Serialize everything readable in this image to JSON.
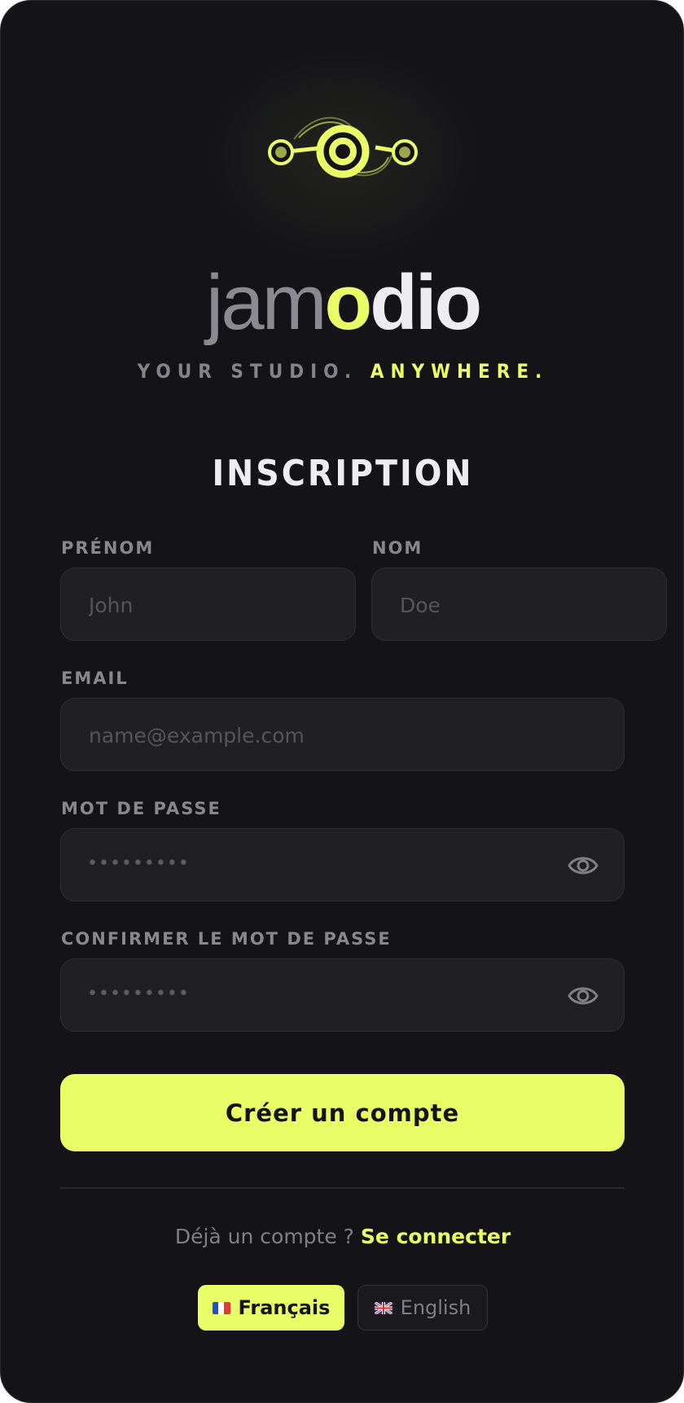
{
  "brand": {
    "wordmark_light": "jam",
    "wordmark_o": "o",
    "wordmark_bold": "dio",
    "tagline_a": "YOUR STUDIO.",
    "tagline_b": "ANYWHERE.",
    "accent_color": "#e8fd66"
  },
  "form": {
    "title": "INSCRIPTION",
    "first_name": {
      "label": "PRÉNOM",
      "placeholder": "John",
      "value": ""
    },
    "last_name": {
      "label": "NOM",
      "placeholder": "Doe",
      "value": ""
    },
    "email": {
      "label": "EMAIL",
      "placeholder": "name@example.com",
      "value": ""
    },
    "password": {
      "label": "MOT DE PASSE",
      "value_mask": "•••••••••",
      "toggle_icon": "eye-icon"
    },
    "confirm_password": {
      "label": "CONFIRMER LE MOT DE PASSE",
      "value_mask": "•••••••••",
      "toggle_icon": "eye-icon"
    },
    "submit_label": "Créer un compte"
  },
  "footer": {
    "have_account": "Déjà un compte ?",
    "signin_link": "Se connecter",
    "languages": [
      {
        "label": "Français",
        "flag": "fr-flag-icon",
        "selected": true
      },
      {
        "label": "English",
        "flag": "uk-flag-icon",
        "selected": false
      }
    ]
  }
}
